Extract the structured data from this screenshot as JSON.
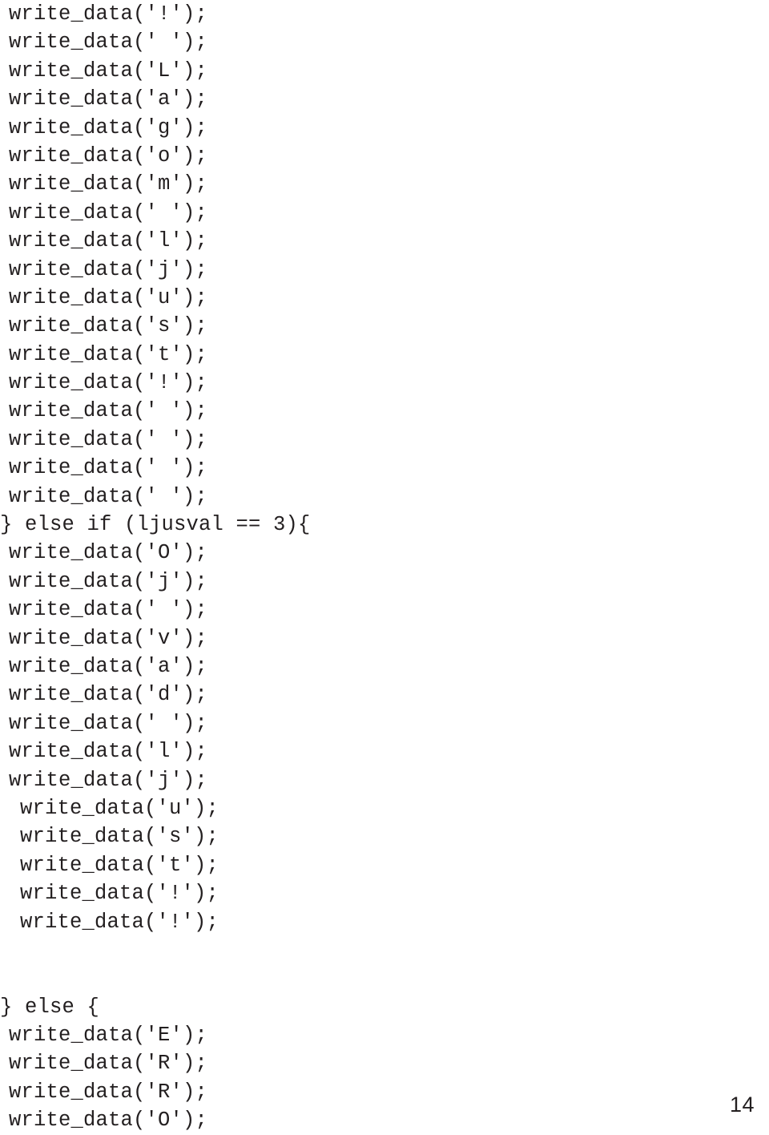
{
  "document": {
    "page_number": "14",
    "language": "c",
    "code_lines": [
      {
        "text": "write_data('!');",
        "indent": 1
      },
      {
        "text": "write_data(' ');",
        "indent": 1
      },
      {
        "text": "write_data('L');",
        "indent": 1
      },
      {
        "text": "write_data('a');",
        "indent": 1
      },
      {
        "text": "write_data('g');",
        "indent": 1
      },
      {
        "text": "write_data('o');",
        "indent": 1
      },
      {
        "text": "write_data('m');",
        "indent": 1
      },
      {
        "text": "write_data(' ');",
        "indent": 1
      },
      {
        "text": "write_data('l');",
        "indent": 1
      },
      {
        "text": "write_data('j');",
        "indent": 1
      },
      {
        "text": "write_data('u');",
        "indent": 1
      },
      {
        "text": "write_data('s');",
        "indent": 1
      },
      {
        "text": "write_data('t');",
        "indent": 1
      },
      {
        "text": "write_data('!');",
        "indent": 1
      },
      {
        "text": "write_data(' ');",
        "indent": 1
      },
      {
        "text": "write_data(' ');",
        "indent": 1
      },
      {
        "text": "write_data(' ');",
        "indent": 1
      },
      {
        "text": "write_data(' ');",
        "indent": 1
      },
      {
        "text": "} else if (ljusval == 3){",
        "indent": 0
      },
      {
        "text": "write_data('O');",
        "indent": 1
      },
      {
        "text": "write_data('j');",
        "indent": 1
      },
      {
        "text": "write_data(' ');",
        "indent": 1
      },
      {
        "text": "write_data('v');",
        "indent": 1
      },
      {
        "text": "write_data('a');",
        "indent": 1
      },
      {
        "text": "write_data('d');",
        "indent": 1
      },
      {
        "text": "write_data(' ');",
        "indent": 1
      },
      {
        "text": "write_data('l');",
        "indent": 1
      },
      {
        "text": "write_data('j');",
        "indent": 1
      },
      {
        "text": "write_data('u');",
        "indent": 2
      },
      {
        "text": "write_data('s');",
        "indent": 2
      },
      {
        "text": "write_data('t');",
        "indent": 2
      },
      {
        "text": "write_data('!');",
        "indent": 2
      },
      {
        "text": "write_data('!');",
        "indent": 2
      },
      {
        "text": "",
        "indent": 0
      },
      {
        "text": "",
        "indent": 0
      },
      {
        "text": "} else {",
        "indent": 0
      },
      {
        "text": "write_data('E');",
        "indent": 1
      },
      {
        "text": "write_data('R');",
        "indent": 1
      },
      {
        "text": "write_data('R');",
        "indent": 1
      },
      {
        "text": "write_data('O');",
        "indent": 1
      }
    ]
  }
}
